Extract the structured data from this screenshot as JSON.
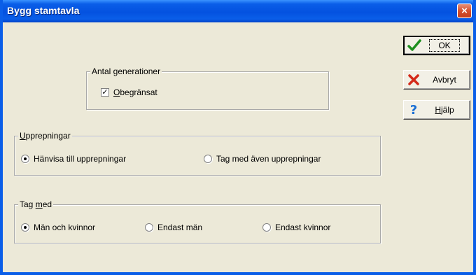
{
  "window": {
    "title": "Bygg stamtavla",
    "close_symbol": "×"
  },
  "generations": {
    "legend": "Antal generationer",
    "unlimited_label": "Obegränsat",
    "unlimited_checked": true
  },
  "repetitions": {
    "legend": "Upprepningar",
    "options": [
      {
        "label": "Hänvisa till upprepningar",
        "selected": true
      },
      {
        "label": "Tag med även upprepningar",
        "selected": false
      }
    ]
  },
  "include": {
    "legend": "Tag med",
    "options": [
      {
        "label": "Män och kvinnor",
        "selected": true
      },
      {
        "label": "Endast män",
        "selected": false
      },
      {
        "label": "Endast kvinnor",
        "selected": false
      }
    ]
  },
  "buttons": {
    "ok": {
      "label": "OK",
      "icon": "checkmark-icon",
      "color": "#1e8f1e"
    },
    "cancel": {
      "label": "Avbryt",
      "icon": "x-mark-icon",
      "color": "#d42a1a"
    },
    "help": {
      "label": "Hjälp",
      "icon": "question-mark-icon",
      "color": "#1a6fd4"
    }
  }
}
